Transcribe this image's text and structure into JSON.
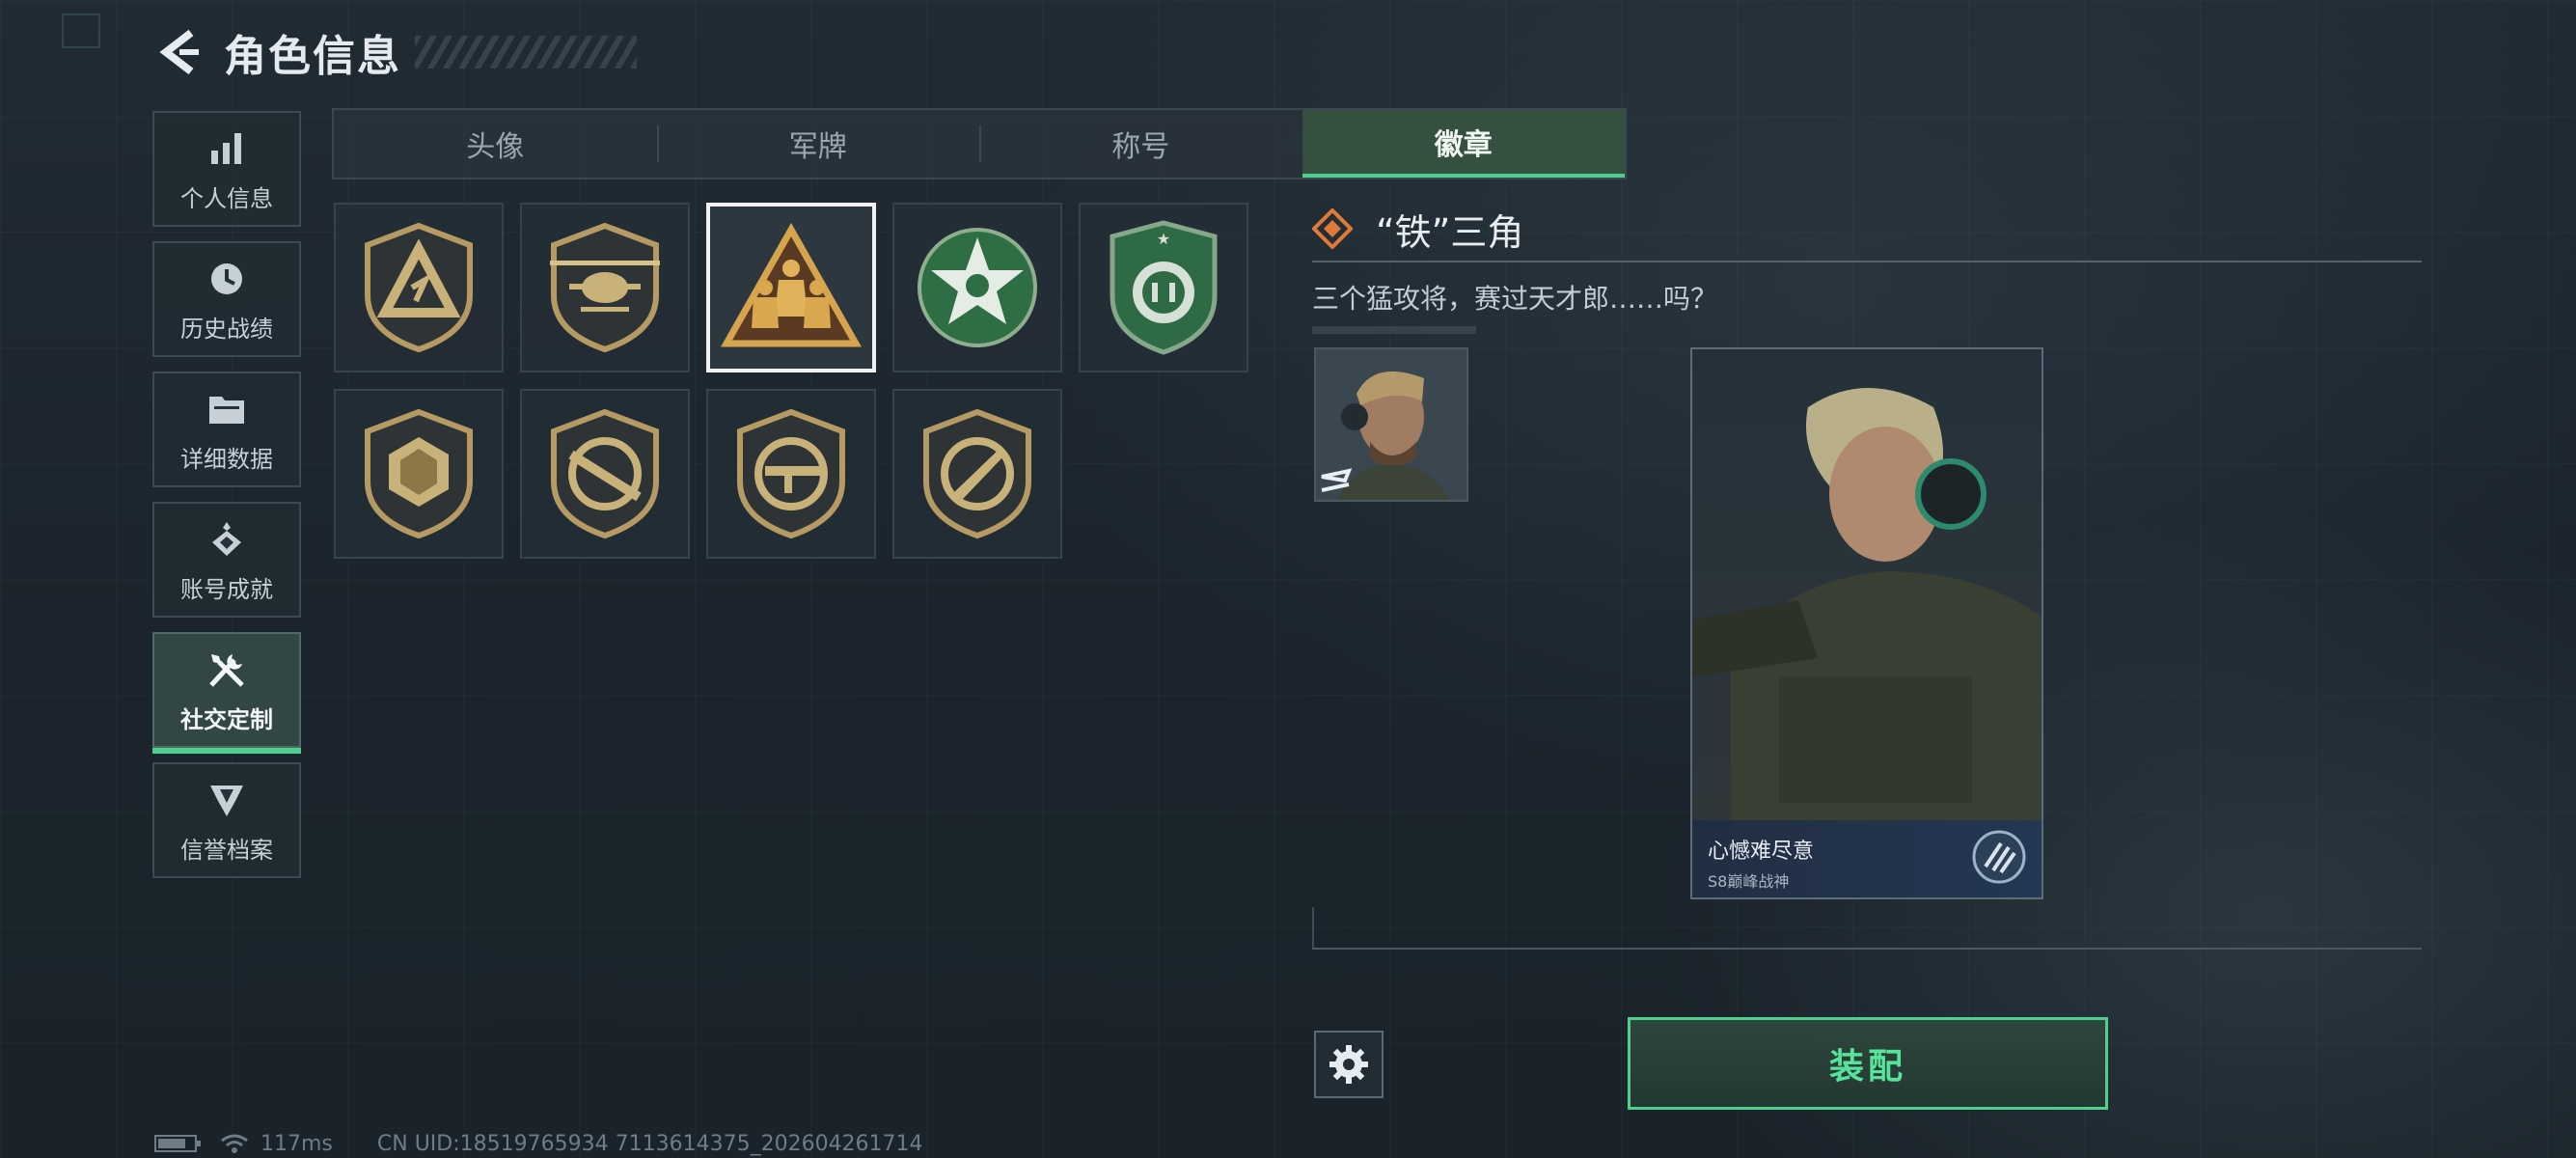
{
  "header": {
    "title": "角色信息"
  },
  "nav": {
    "items": [
      {
        "label": "个人信息",
        "icon": "bar-chart-icon"
      },
      {
        "label": "历史战绩",
        "icon": "history-clock-icon"
      },
      {
        "label": "详细数据",
        "icon": "folder-icon"
      },
      {
        "label": "账号成就",
        "icon": "achievement-icon"
      },
      {
        "label": "社交定制",
        "icon": "tools-icon",
        "active": true
      },
      {
        "label": "信誉档案",
        "icon": "reputation-icon"
      }
    ]
  },
  "tabs": [
    {
      "label": "头像"
    },
    {
      "label": "军牌"
    },
    {
      "label": "称号"
    },
    {
      "label": "徽章",
      "active": true
    }
  ],
  "badges": [
    {
      "name": "triangle-badge",
      "icon": "triangle-shield-badge-icon"
    },
    {
      "name": "helicopter-badge",
      "icon": "helicopter-badge-icon"
    },
    {
      "name": "iron-triangle-badge",
      "icon": "three-soldiers-triangle-badge-icon",
      "selected": true
    },
    {
      "name": "green-star-badge",
      "icon": "green-star-badge-icon"
    },
    {
      "name": "green-shield-badge",
      "icon": "green-shield-badge-icon"
    },
    {
      "name": "hexagon-badge",
      "icon": "hexagon-gem-badge-icon"
    },
    {
      "name": "rifle-badge",
      "icon": "rifle-badge-icon"
    },
    {
      "name": "smg-badge",
      "icon": "smg-badge-icon"
    },
    {
      "name": "knife-badge",
      "icon": "knife-badge-icon"
    }
  ],
  "detail": {
    "title": "“铁”三角",
    "description": "三个猛攻将，赛过天才郎……吗？"
  },
  "card": {
    "name": "心憾难尽意",
    "subtitle": "S8巅峰战神"
  },
  "buttons": {
    "equip": "装配"
  },
  "status": {
    "ping": "117ms",
    "uid": "CN UID:18519765934 7113614375_202604261714"
  },
  "colors": {
    "accent": "#4fcf8c",
    "active_tab_bg": "#35503f",
    "badge_gold": "#c8a66a",
    "badge_green": "#2f7a4b",
    "diamond_orange": "#e07a3a"
  }
}
